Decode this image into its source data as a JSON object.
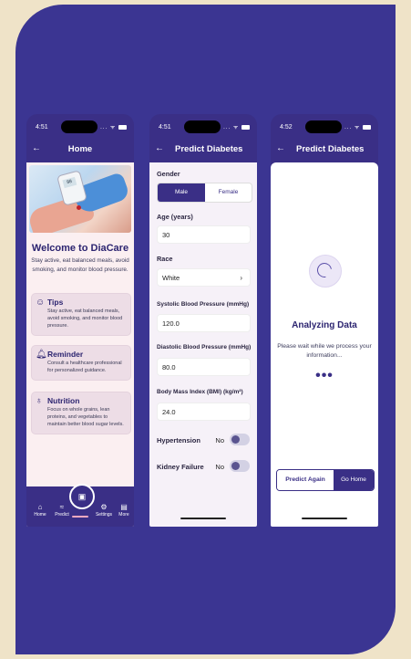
{
  "colors": {
    "primary": "#3a2f86",
    "background": "#efe3c8",
    "card": "#3b3592"
  },
  "home_screen": {
    "status_time": "4:51",
    "status_icons": "... ᯤ",
    "title": "Home",
    "hero_meter_value": "88",
    "welcome_title": "Welcome to DiaCare",
    "welcome_subtitle": "Stay active, eat balanced meals, avoid smoking, and monitor blood pressure.",
    "cards": [
      {
        "icon": "smile-icon",
        "title": "Tips",
        "text": "Stay active, eat balanced meals, avoid smoking, and monitor blood pressure."
      },
      {
        "icon": "bell-icon",
        "title": "Reminder",
        "text": "Consult a healthcare professional for personalized guidance."
      },
      {
        "icon": "apple-icon",
        "title": "Nutrition",
        "text": "Focus on whole grains, lean proteins, and vegetables to maintain better blood sugar levels."
      }
    ],
    "nav": {
      "home": "Home",
      "predict": "Predict",
      "settings": "Settings",
      "more": "More"
    }
  },
  "predict_screen": {
    "status_time": "4:51",
    "status_icons": "... ᯤ",
    "title": "Predict Diabetes",
    "gender_label": "Gender",
    "gender_options": [
      "Male",
      "Female"
    ],
    "gender_selected": "Male",
    "age_label": "Age (years)",
    "age_value": "30",
    "race_label": "Race",
    "race_value": "White",
    "systolic_label": "Systolic Blood Pressure (mmHg)",
    "systolic_value": "120.0",
    "diastolic_label": "Diastolic Blood Pressure (mmHg)",
    "diastolic_value": "80.0",
    "bmi_label": "Body Mass Index (BMI) (kg/m²)",
    "bmi_value": "24.0",
    "hypertension_label": "Hypertension",
    "hypertension_value": "No",
    "kidney_label": "Kidney Failure",
    "kidney_value": "No"
  },
  "analyzing_screen": {
    "status_time": "4:52",
    "status_icons": "... ᯤ",
    "title": "Predict Diabetes",
    "heading": "Analyzing Data",
    "message": "Please wait while we process your information...",
    "dots": "•••",
    "predict_again": "Predict Again",
    "go_home": "Go Home"
  }
}
